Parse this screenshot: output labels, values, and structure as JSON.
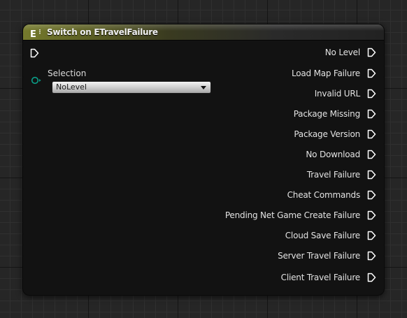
{
  "node": {
    "icon": "enum-icon",
    "icon_text": "E",
    "title": "Switch on ETravelFailure",
    "header_color": "#757a2d",
    "data_pin_color": "#0aa08a"
  },
  "input": {
    "selection_label": "Selection",
    "selection_value": "NoLevel"
  },
  "outputs": [
    "No Level",
    "Load Map Failure",
    "Invalid URL",
    "Package Missing",
    "Package Version",
    "No Download",
    "Travel Failure",
    "Cheat Commands",
    "Pending Net Game Create Failure",
    "Cloud Save Failure",
    "Server Travel Failure",
    "Client Travel Failure"
  ]
}
